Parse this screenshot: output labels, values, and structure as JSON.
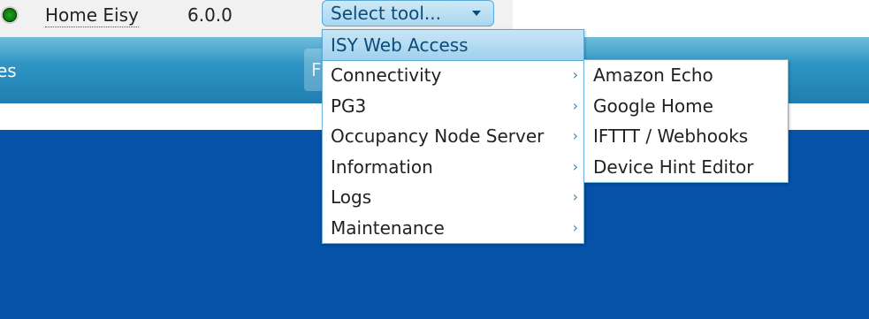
{
  "device": {
    "name": "Home Eisy",
    "version": "6.0.0",
    "status_color": "#1ea31e"
  },
  "tool_select": {
    "label": "Select tool..."
  },
  "nav": {
    "left_fragment": "es",
    "right_fragment": "F"
  },
  "menu": {
    "items": [
      {
        "label": "ISY Web Access",
        "has_submenu": false
      },
      {
        "label": "Connectivity",
        "has_submenu": true
      },
      {
        "label": "PG3",
        "has_submenu": true
      },
      {
        "label": "Occupancy Node Server",
        "has_submenu": true
      },
      {
        "label": "Information",
        "has_submenu": true
      },
      {
        "label": "Logs",
        "has_submenu": true
      },
      {
        "label": "Maintenance",
        "has_submenu": true
      }
    ],
    "arrow_glyph": "›"
  },
  "submenu": {
    "items": [
      {
        "label": "Amazon Echo"
      },
      {
        "label": "Google Home"
      },
      {
        "label": "IFTTT / Webhooks"
      },
      {
        "label": "Device Hint Editor"
      }
    ]
  },
  "colors": {
    "nav_blue": "#2a8fbf",
    "page_blue": "#0552a8",
    "accent": "#5aa9d6"
  }
}
